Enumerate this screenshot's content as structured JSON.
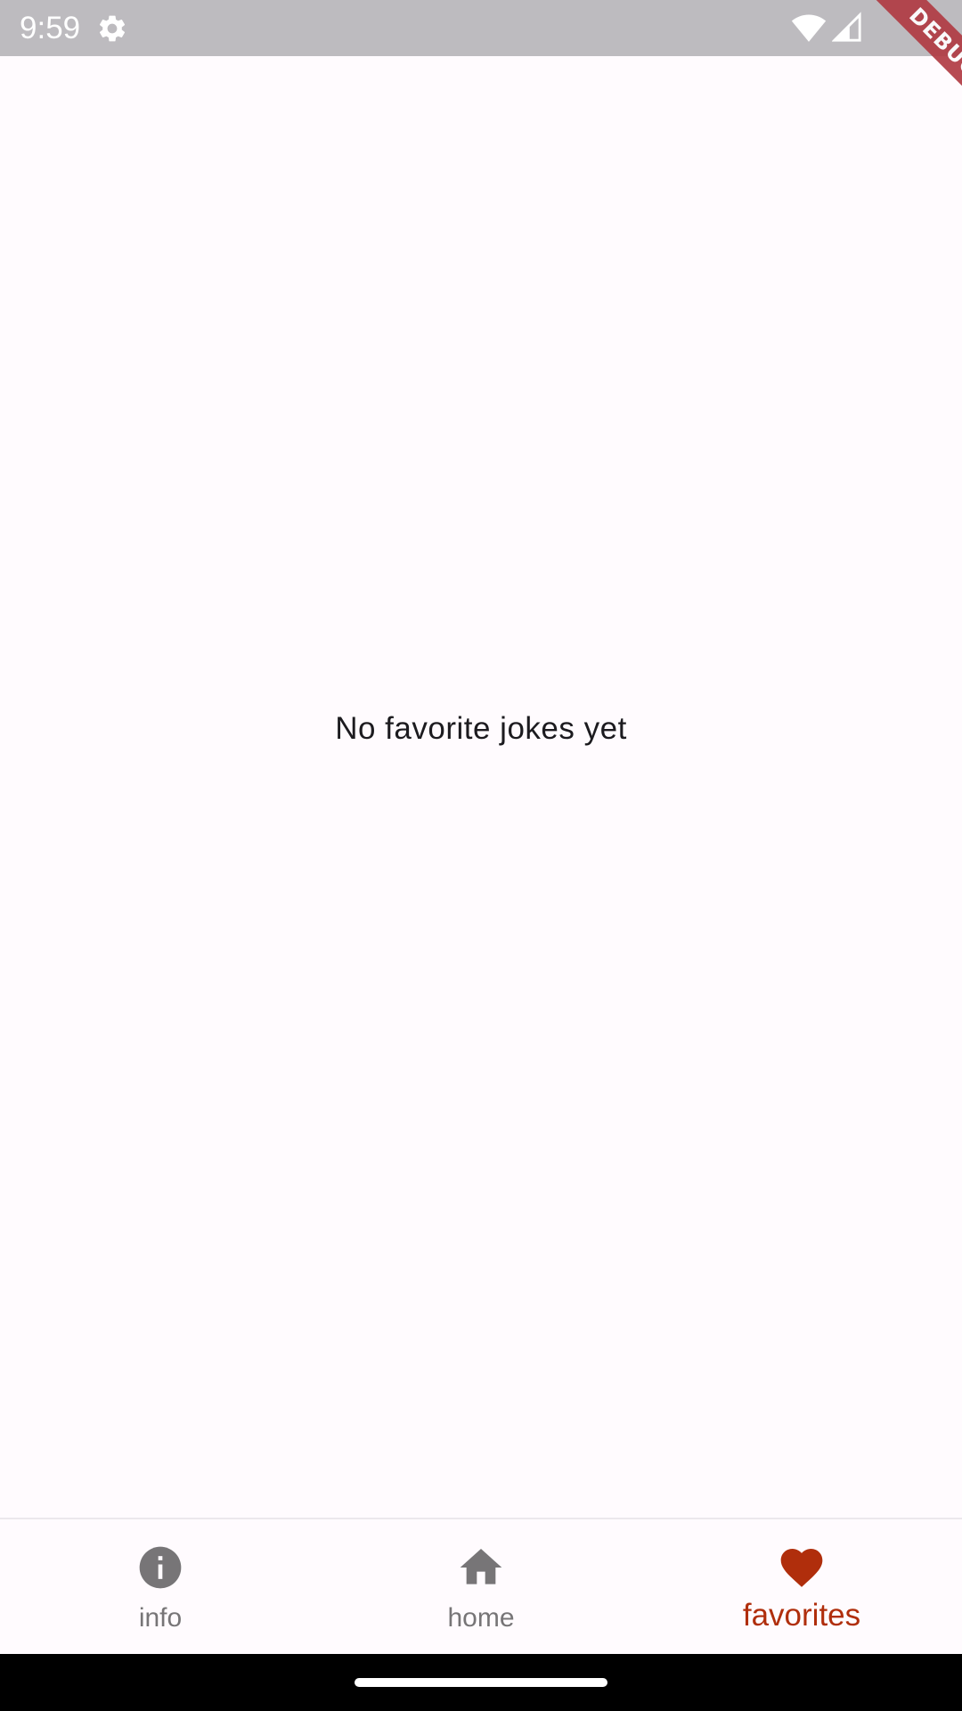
{
  "status_bar": {
    "time": "9:59",
    "icons": [
      "gear-icon",
      "wifi-icon",
      "signal-icon"
    ]
  },
  "debug_banner": {
    "label": "DEBUG"
  },
  "main": {
    "empty_message": "No favorite jokes yet"
  },
  "bottom_nav": {
    "items": [
      {
        "label": "info",
        "icon": "info-icon",
        "active": false
      },
      {
        "label": "home",
        "icon": "home-icon",
        "active": false
      },
      {
        "label": "favorites",
        "icon": "heart-icon",
        "active": true
      }
    ]
  },
  "colors": {
    "accent": "#b02e0c",
    "inactive": "#777577",
    "background": "#fffbfe",
    "status_bar": "#bdbbbf"
  }
}
